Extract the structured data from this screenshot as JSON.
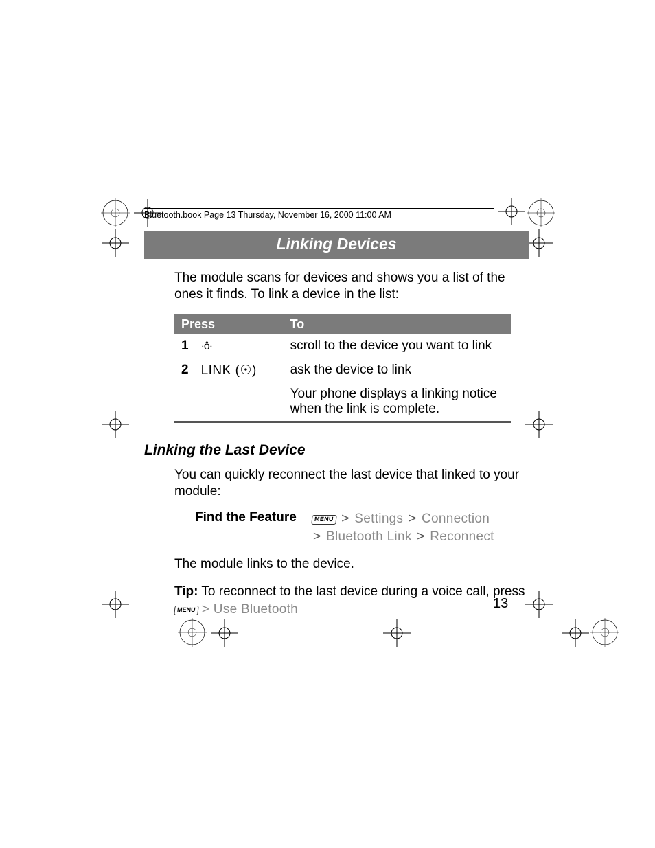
{
  "header": "Bluetooth.book  Page 13  Thursday, November 16, 2000  11:00 AM",
  "banner": "Linking Devices",
  "intro": "The module scans for devices and shows you a list of the ones it finds. To link a device in the list:",
  "table": {
    "head_press": "Press",
    "head_to": "To",
    "rows": [
      {
        "n": "1",
        "press": "·ô·",
        "to": "scroll to the device you want to link"
      },
      {
        "n": "2",
        "press": "LINK (☉)",
        "to_a": "ask the device to link",
        "to_b": "Your phone displays a linking notice when the link is complete."
      }
    ]
  },
  "subhead": "Linking the Last Device",
  "subintro": "You can quickly reconnect the last device that linked to your module:",
  "feature": {
    "label": "Find the Feature",
    "menu_key": "MENU",
    "sep": ">",
    "path": [
      "Settings",
      "Connection",
      "Bluetooth Link",
      "Reconnect"
    ]
  },
  "links_text": "The module links to the device.",
  "tip": {
    "label": "Tip:",
    "text": " To reconnect to the last device during a voice call, press ",
    "menu_key": "MENU",
    "sep": ">",
    "action": "Use Bluetooth"
  },
  "page_num": "13"
}
